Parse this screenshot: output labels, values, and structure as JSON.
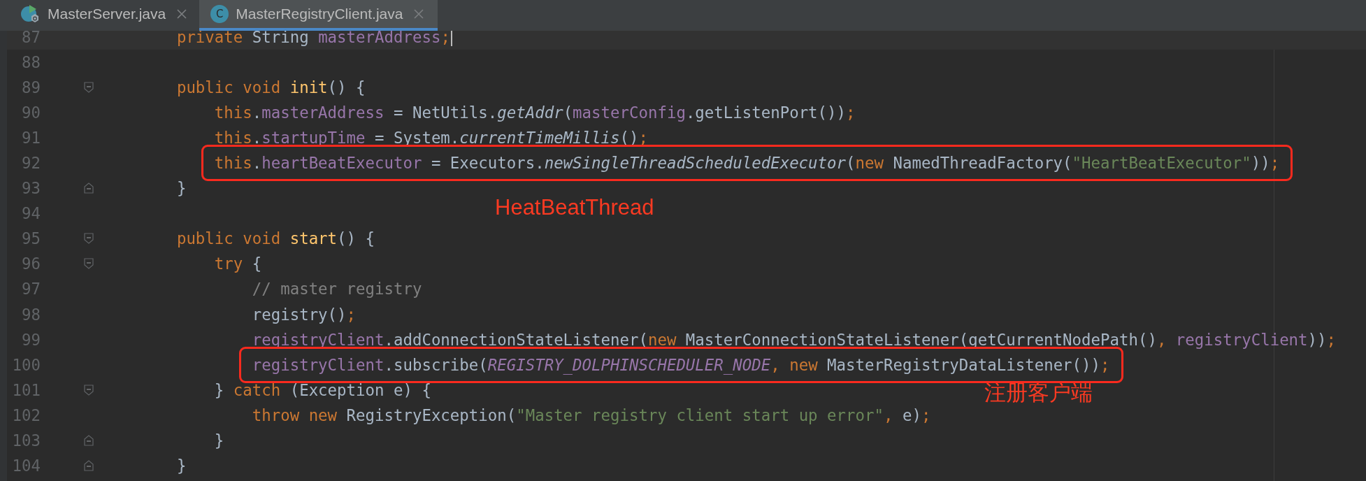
{
  "tabs": [
    {
      "label": "MasterServer.java",
      "kind": "runnable",
      "selected": false
    },
    {
      "label": "MasterRegistryClient.java",
      "kind": "class",
      "icon_letter": "C",
      "selected": true
    }
  ],
  "editor": {
    "lines": [
      {
        "number": "87",
        "current": true,
        "cursor": true,
        "tokens": [
          {
            "kind": "keyword",
            "text": "    private"
          },
          {
            "kind": "plain",
            "text": " String "
          },
          {
            "kind": "field",
            "text": "masterAddress"
          },
          {
            "kind": "punct",
            "text": ";"
          }
        ]
      },
      {
        "number": "88"
      },
      {
        "number": "89",
        "fold_start": true,
        "tokens": [
          {
            "kind": "keyword",
            "text": "    public void "
          },
          {
            "kind": "method",
            "text": "init"
          },
          {
            "kind": "plain",
            "text": "() {"
          }
        ]
      },
      {
        "number": "90",
        "tokens": [
          {
            "kind": "keyword",
            "text": "        this"
          },
          {
            "kind": "plain",
            "text": "."
          },
          {
            "kind": "field",
            "text": "masterAddress"
          },
          {
            "kind": "plain",
            "text": " = NetUtils."
          },
          {
            "kind": "static",
            "text": "getAddr"
          },
          {
            "kind": "plain",
            "text": "("
          },
          {
            "kind": "field",
            "text": "masterConfig"
          },
          {
            "kind": "plain",
            "text": ".getListenPort())"
          },
          {
            "kind": "punct",
            "text": ";"
          }
        ]
      },
      {
        "number": "91",
        "tokens": [
          {
            "kind": "keyword",
            "text": "        this"
          },
          {
            "kind": "plain",
            "text": "."
          },
          {
            "kind": "field",
            "text": "startupTime"
          },
          {
            "kind": "plain",
            "text": " = System."
          },
          {
            "kind": "static",
            "text": "currentTimeMillis"
          },
          {
            "kind": "plain",
            "text": "()"
          },
          {
            "kind": "punct",
            "text": ";"
          }
        ]
      },
      {
        "number": "92",
        "boxed": true,
        "tokens": [
          {
            "kind": "keyword",
            "text": "        this"
          },
          {
            "kind": "plain",
            "text": "."
          },
          {
            "kind": "field",
            "text": "heartBeatExecutor"
          },
          {
            "kind": "plain",
            "text": " = Executors."
          },
          {
            "kind": "static",
            "text": "newSingleThreadScheduledExecutor"
          },
          {
            "kind": "plain",
            "text": "("
          },
          {
            "kind": "keyword",
            "text": "new"
          },
          {
            "kind": "plain",
            "text": " NamedThreadFactory("
          },
          {
            "kind": "string",
            "text": "\"HeartBeatExecutor\""
          },
          {
            "kind": "plain",
            "text": "))"
          },
          {
            "kind": "punct",
            "text": ";"
          }
        ]
      },
      {
        "number": "93",
        "fold_end": true,
        "tokens": [
          {
            "kind": "plain",
            "text": "    }"
          }
        ]
      },
      {
        "number": "94",
        "note": "HeatBeatThread"
      },
      {
        "number": "95",
        "fold_start": true,
        "tokens": [
          {
            "kind": "keyword",
            "text": "    public void "
          },
          {
            "kind": "method",
            "text": "start"
          },
          {
            "kind": "plain",
            "text": "() {"
          }
        ]
      },
      {
        "number": "96",
        "fold_start": true,
        "tokens": [
          {
            "kind": "keyword",
            "text": "        try"
          },
          {
            "kind": "plain",
            "text": " {"
          }
        ]
      },
      {
        "number": "97",
        "tokens": [
          {
            "kind": "comment",
            "text": "            // master registry"
          }
        ]
      },
      {
        "number": "98",
        "tokens": [
          {
            "kind": "plain",
            "text": "            registry()"
          },
          {
            "kind": "punct",
            "text": ";"
          }
        ]
      },
      {
        "number": "99",
        "tokens": [
          {
            "kind": "field",
            "text": "            registryClient"
          },
          {
            "kind": "plain",
            "text": ".addConnectionStateListener("
          },
          {
            "kind": "keyword",
            "text": "new"
          },
          {
            "kind": "plain",
            "text": " MasterConnectionStateListener(getCurrentNodePath()"
          },
          {
            "kind": "punct",
            "text": ", "
          },
          {
            "kind": "field",
            "text": "registryClient"
          },
          {
            "kind": "plain",
            "text": "))"
          },
          {
            "kind": "punct",
            "text": ";"
          }
        ]
      },
      {
        "number": "100",
        "boxed": true,
        "tokens": [
          {
            "kind": "field",
            "text": "            registryClient"
          },
          {
            "kind": "plain",
            "text": ".subscribe("
          },
          {
            "kind": "constant",
            "text": "REGISTRY_DOLPHINSCHEDULER_NODE"
          },
          {
            "kind": "punct",
            "text": ", "
          },
          {
            "kind": "keyword",
            "text": "new"
          },
          {
            "kind": "plain",
            "text": " MasterRegistryDataListener())"
          },
          {
            "kind": "punct",
            "text": ";"
          }
        ]
      },
      {
        "number": "101",
        "fold_start": true,
        "note": "注册客户端",
        "tokens": [
          {
            "kind": "plain",
            "text": "        } "
          },
          {
            "kind": "keyword",
            "text": "catch"
          },
          {
            "kind": "plain",
            "text": " (Exception e) {"
          }
        ]
      },
      {
        "number": "102",
        "tokens": [
          {
            "kind": "keyword",
            "text": "            throw new"
          },
          {
            "kind": "plain",
            "text": " RegistryException("
          },
          {
            "kind": "string",
            "text": "\"Master registry client start up error\""
          },
          {
            "kind": "punct",
            "text": ", "
          },
          {
            "kind": "plain",
            "text": "e)"
          },
          {
            "kind": "punct",
            "text": ";"
          }
        ]
      },
      {
        "number": "103",
        "fold_end": true,
        "tokens": [
          {
            "kind": "plain",
            "text": "        }"
          }
        ]
      },
      {
        "number": "104",
        "fold_end": true,
        "tokens": [
          {
            "kind": "plain",
            "text": "    }"
          }
        ]
      }
    ]
  }
}
